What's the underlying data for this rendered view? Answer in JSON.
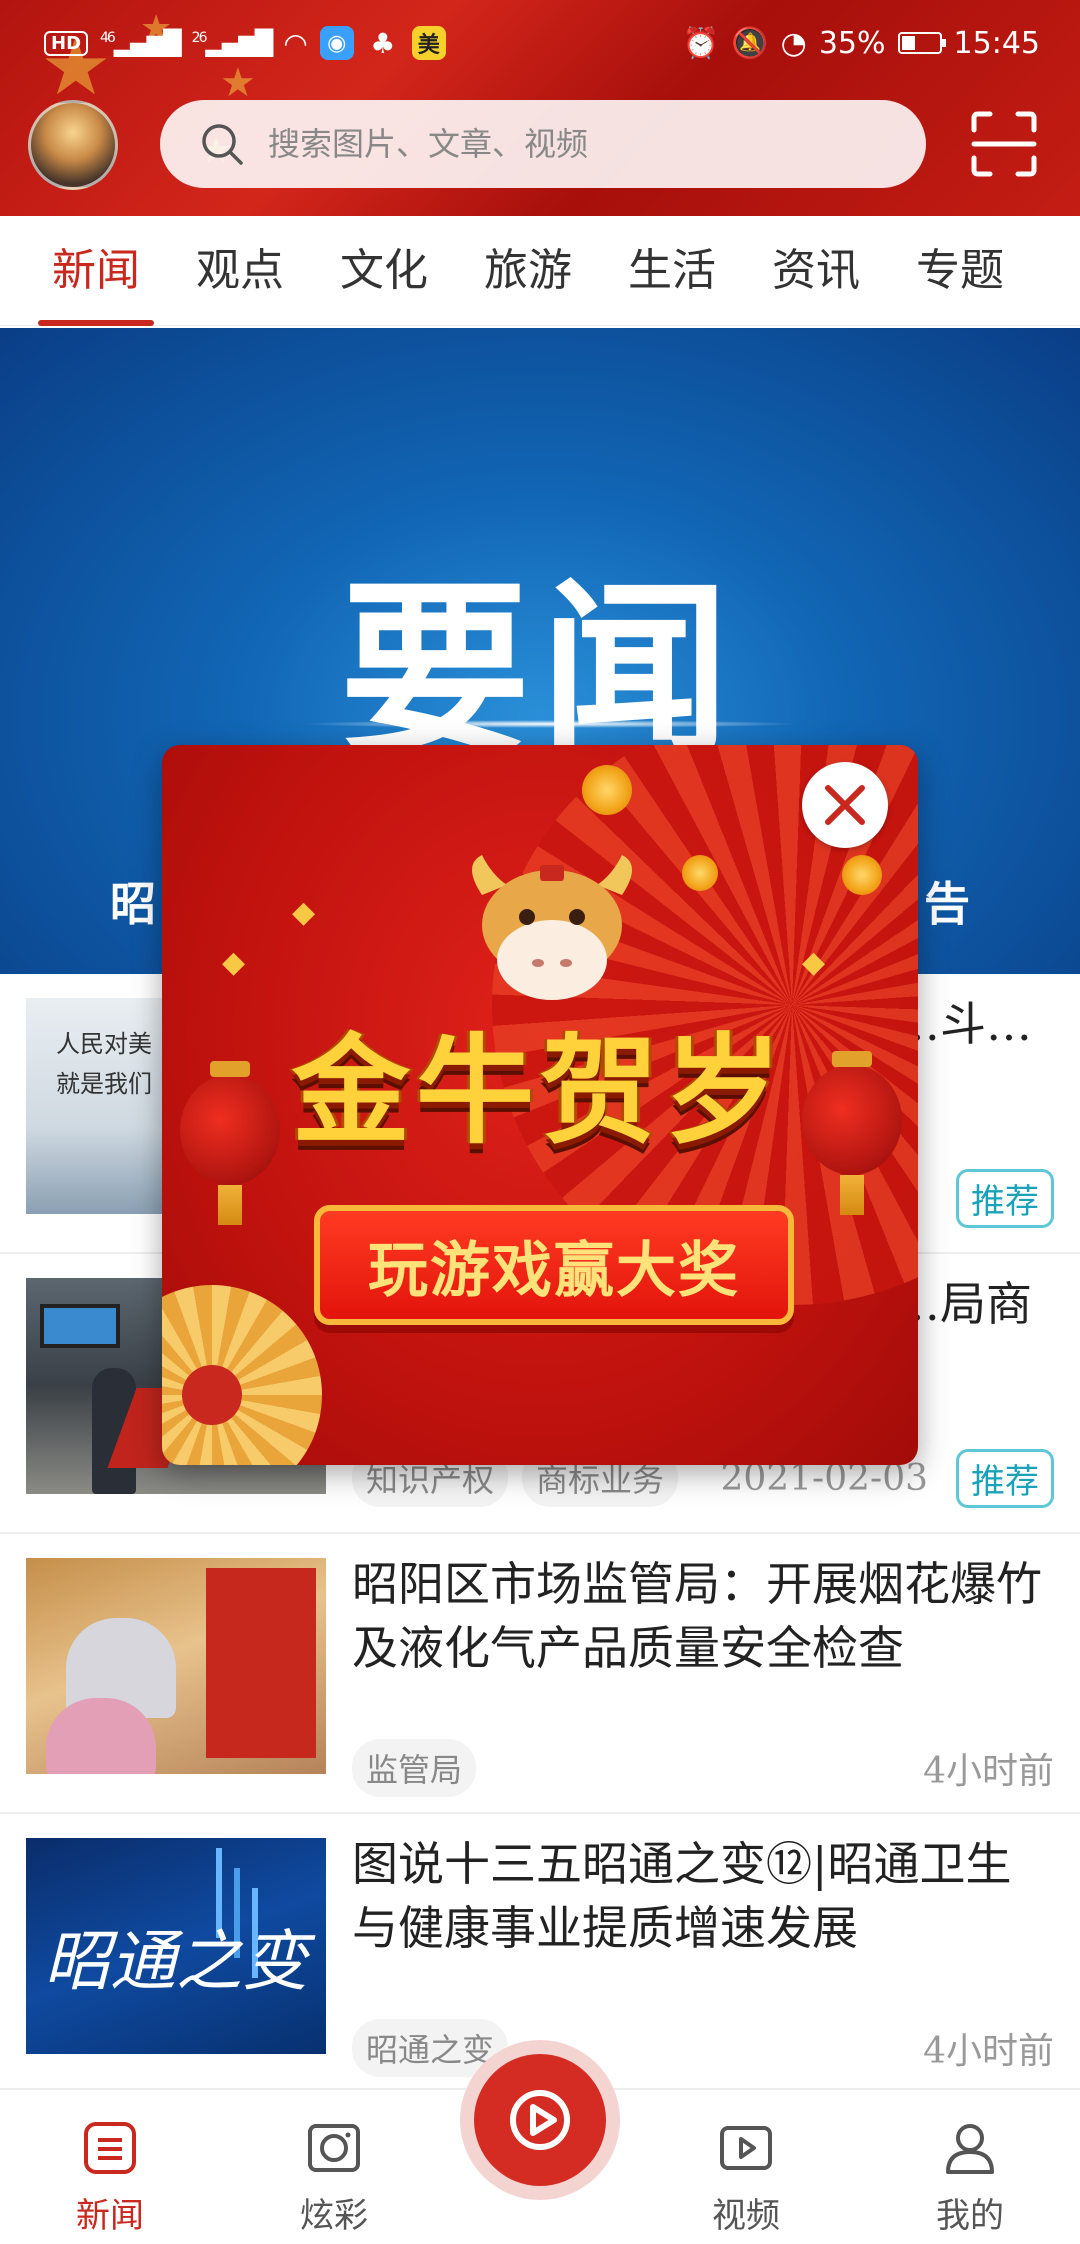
{
  "status_bar": {
    "network_badge": "HD",
    "signal_1": "46",
    "signal_2": "26",
    "app_badge": "美",
    "battery": "35%",
    "time": "15:45"
  },
  "header": {
    "search_placeholder": "搜索图片、文章、视频"
  },
  "tabs": [
    "新闻",
    "观点",
    "文化",
    "旅游",
    "生活",
    "资讯",
    "专题"
  ],
  "banner": {
    "headline": "要闻",
    "caption_left": "昭",
    "caption_right": "告"
  },
  "news": [
    {
      "title": "…美好…斗…",
      "thumb_text_1": "人民对美",
      "thumb_text_2": "就是我们",
      "tags": [],
      "time": "",
      "recommend": "推荐"
    },
    {
      "title": "…局商",
      "tags": [
        "知识产权",
        "商标业务"
      ],
      "time": "2021-02-03",
      "recommend": "推荐"
    },
    {
      "title": "昭阳区市场监管局：开展烟花爆竹及液化气产品质量安全检查",
      "tags": [
        "监管局"
      ],
      "time": "4小时前"
    },
    {
      "title": "图说十三五昭通之变⑫|昭通卫生与健康事业提质增速发展",
      "thumb_text": "昭通之变",
      "tags": [
        "昭通之变"
      ],
      "time": "4小时前"
    }
  ],
  "bottom_nav": [
    {
      "label": "新闻",
      "icon": "news-icon",
      "active": true
    },
    {
      "label": "炫彩",
      "icon": "camera-icon",
      "active": false
    },
    {
      "label": "",
      "icon": "play-icon",
      "active": false
    },
    {
      "label": "视频",
      "icon": "video-icon",
      "active": false
    },
    {
      "label": "我的",
      "icon": "profile-icon",
      "active": false
    }
  ],
  "popup": {
    "title": "金牛贺岁",
    "cta": "玩游戏赢大奖"
  },
  "colors": {
    "brand_red": "#c8281e",
    "recommend_teal": "#1aa3b8",
    "banner_blue": "#1166b5"
  }
}
